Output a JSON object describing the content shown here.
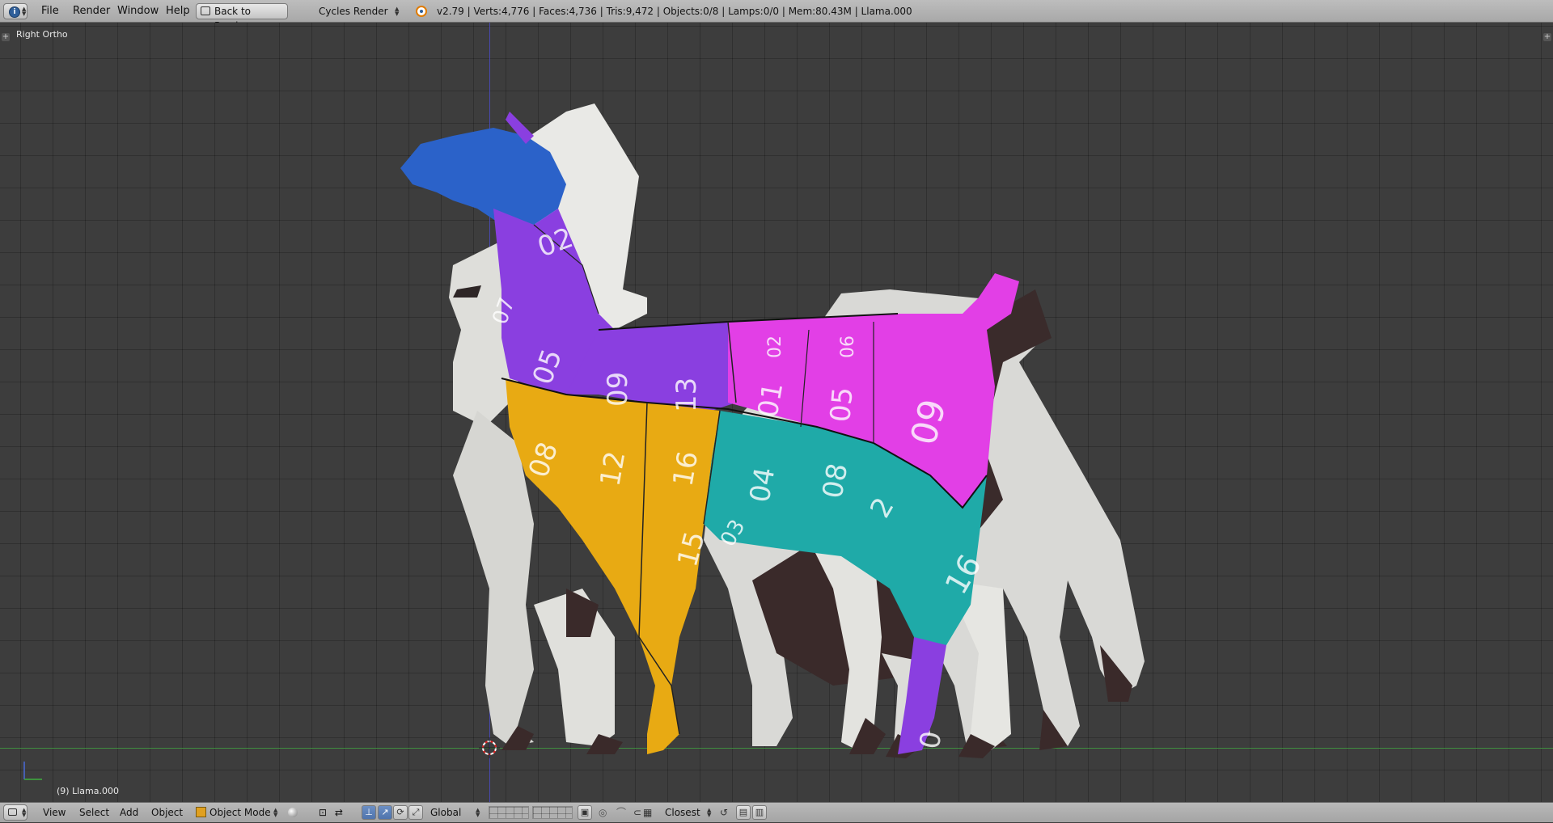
{
  "top_header": {
    "menus": [
      "File",
      "Render",
      "Window",
      "Help"
    ],
    "back_button_label": "Back to Previous",
    "render_engine": "Cycles Render",
    "stats": "v2.79 | Verts:4,776 | Faces:4,736 | Tris:9,472 | Objects:0/8 | Lamps:0/0 | Mem:80.43M | Llama.000"
  },
  "viewport": {
    "view_label": "Right Ortho",
    "object_label": "(9) Llama.000",
    "uv_numbers": [
      "02",
      "07",
      "05",
      "09",
      "13",
      "01",
      "05",
      "09",
      "02",
      "06",
      "08",
      "12",
      "16",
      "04",
      "08",
      "03",
      "15",
      "16",
      "2",
      "0"
    ]
  },
  "bottom_header": {
    "menus": [
      "View",
      "Select",
      "Add",
      "Object"
    ],
    "mode": "Object Mode",
    "orientation": "Global",
    "snap_target": "Closest"
  },
  "colors": {
    "head": "#2b62c9",
    "neck": "#8a3fe0",
    "rear": "#e23fe6",
    "legs_front": "#e8aa13",
    "belly": "#1faaa8",
    "body_white": "#e5e5e2",
    "dark": "#3a2a2a"
  }
}
